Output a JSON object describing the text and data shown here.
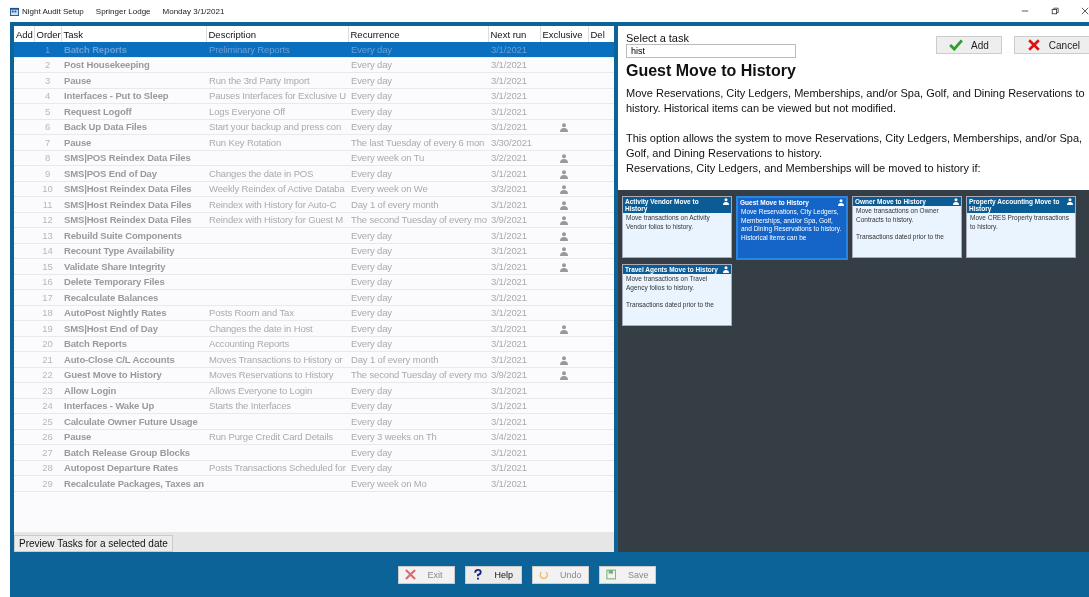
{
  "title_bar": {
    "app": "Night Audit Setup",
    "property": "Springer Lodge",
    "date": "Monday 3/1/2021"
  },
  "table": {
    "columns": [
      "Add",
      "Order",
      "Task",
      "Description",
      "Recurrence",
      "Next run",
      "Exclusive",
      "Del"
    ],
    "rows": [
      {
        "order": "1",
        "task": "Batch Reports",
        "description": "Preliminary Reports",
        "recurrence": "Every day",
        "next_run": "3/1/2021",
        "exclusive": false,
        "selected": true
      },
      {
        "order": "2",
        "task": "Post Housekeeping",
        "description": "",
        "recurrence": "Every day",
        "next_run": "3/1/2021",
        "exclusive": false,
        "selected": false
      },
      {
        "order": "3",
        "task": "Pause",
        "description": "Run the 3rd Party Import",
        "recurrence": "Every day",
        "next_run": "3/1/2021",
        "exclusive": false,
        "selected": false
      },
      {
        "order": "4",
        "task": "Interfaces - Put to Sleep",
        "description": "Pauses Interfaces for Exclusive U",
        "recurrence": "Every day",
        "next_run": "3/1/2021",
        "exclusive": false,
        "selected": false
      },
      {
        "order": "5",
        "task": "Request Logoff",
        "description": "Logs Everyone Off",
        "recurrence": "Every day",
        "next_run": "3/1/2021",
        "exclusive": false,
        "selected": false
      },
      {
        "order": "6",
        "task": "Back Up Data Files",
        "description": "Start your backup and press con",
        "recurrence": "Every day",
        "next_run": "3/1/2021",
        "exclusive": true,
        "selected": false
      },
      {
        "order": "7",
        "task": "Pause",
        "description": "Run Key Rotation",
        "recurrence": "The last Tuesday of every 6 mon",
        "next_run": "3/30/2021",
        "exclusive": false,
        "selected": false
      },
      {
        "order": "8",
        "task": "SMS|POS Reindex Data Files",
        "description": "",
        "recurrence": "Every week on Tu",
        "next_run": "3/2/2021",
        "exclusive": true,
        "selected": false
      },
      {
        "order": "9",
        "task": "SMS|POS End of Day",
        "description": "Changes the date in POS",
        "recurrence": "Every day",
        "next_run": "3/1/2021",
        "exclusive": true,
        "selected": false
      },
      {
        "order": "10",
        "task": "SMS|Host Reindex Data Files",
        "description": "Weekly Reindex of Active Databa",
        "recurrence": "Every week on We",
        "next_run": "3/3/2021",
        "exclusive": true,
        "selected": false
      },
      {
        "order": "11",
        "task": "SMS|Host Reindex Data Files",
        "description": "Reindex with History for Auto-C",
        "recurrence": "Day 1 of every month",
        "next_run": "3/1/2021",
        "exclusive": true,
        "selected": false
      },
      {
        "order": "12",
        "task": "SMS|Host Reindex Data Files",
        "description": "Reindex with History for Guest M",
        "recurrence": "The second Tuesday of every mo",
        "next_run": "3/9/2021",
        "exclusive": true,
        "selected": false
      },
      {
        "order": "13",
        "task": "Rebuild Suite Components",
        "description": "",
        "recurrence": "Every day",
        "next_run": "3/1/2021",
        "exclusive": true,
        "selected": false
      },
      {
        "order": "14",
        "task": "Recount Type Availability",
        "description": "",
        "recurrence": "Every day",
        "next_run": "3/1/2021",
        "exclusive": true,
        "selected": false
      },
      {
        "order": "15",
        "task": "Validate Share Integrity",
        "description": "",
        "recurrence": "Every day",
        "next_run": "3/1/2021",
        "exclusive": true,
        "selected": false
      },
      {
        "order": "16",
        "task": "Delete Temporary Files",
        "description": "",
        "recurrence": "Every day",
        "next_run": "3/1/2021",
        "exclusive": false,
        "selected": false
      },
      {
        "order": "17",
        "task": "Recalculate Balances",
        "description": "",
        "recurrence": "Every day",
        "next_run": "3/1/2021",
        "exclusive": false,
        "selected": false
      },
      {
        "order": "18",
        "task": "AutoPost Nightly Rates",
        "description": "Posts Room and Tax",
        "recurrence": "Every day",
        "next_run": "3/1/2021",
        "exclusive": false,
        "selected": false
      },
      {
        "order": "19",
        "task": "SMS|Host End of Day",
        "description": "Changes the date in Host",
        "recurrence": "Every day",
        "next_run": "3/1/2021",
        "exclusive": true,
        "selected": false
      },
      {
        "order": "20",
        "task": "Batch Reports",
        "description": "Accounting Reports",
        "recurrence": "Every day",
        "next_run": "3/1/2021",
        "exclusive": false,
        "selected": false
      },
      {
        "order": "21",
        "task": "Auto-Close C/L Accounts",
        "description": "Moves Transactions to History or",
        "recurrence": "Day 1 of every month",
        "next_run": "3/1/2021",
        "exclusive": true,
        "selected": false
      },
      {
        "order": "22",
        "task": "Guest Move to History",
        "description": "Moves Reservations to History",
        "recurrence": "The second Tuesday of every mo",
        "next_run": "3/9/2021",
        "exclusive": true,
        "selected": false
      },
      {
        "order": "23",
        "task": "Allow Login",
        "description": "Allows Everyone to Login",
        "recurrence": "Every day",
        "next_run": "3/1/2021",
        "exclusive": false,
        "selected": false
      },
      {
        "order": "24",
        "task": "Interfaces - Wake Up",
        "description": "Starts the Interfaces",
        "recurrence": "Every day",
        "next_run": "3/1/2021",
        "exclusive": false,
        "selected": false
      },
      {
        "order": "25",
        "task": "Calculate Owner Future Usage",
        "description": "",
        "recurrence": "Every day",
        "next_run": "3/1/2021",
        "exclusive": false,
        "selected": false
      },
      {
        "order": "26",
        "task": "Pause",
        "description": "Run Purge Credit Card Details",
        "recurrence": "Every 3 weeks on Th",
        "next_run": "3/4/2021",
        "exclusive": false,
        "selected": false
      },
      {
        "order": "27",
        "task": "Batch Release Group Blocks",
        "description": "",
        "recurrence": "Every day",
        "next_run": "3/1/2021",
        "exclusive": false,
        "selected": false
      },
      {
        "order": "28",
        "task": "Autopost Departure Rates",
        "description": "Posts Transactions Scheduled for",
        "recurrence": "Every day",
        "next_run": "3/1/2021",
        "exclusive": false,
        "selected": false
      },
      {
        "order": "29",
        "task": "Recalculate Packages, Taxes an",
        "description": "",
        "recurrence": "Every week on Mo",
        "next_run": "3/1/2021",
        "exclusive": false,
        "selected": false
      }
    ]
  },
  "preview_tab": "Preview Tasks for a selected date",
  "task_picker": {
    "label": "Select a task",
    "search_value": "hist",
    "add": "Add",
    "cancel": "Cancel",
    "heading": "Guest Move to History",
    "paragraphs": [
      "Move Reservations, City Ledgers, Memberships, and/or Spa, Golf, and Dining Reservations to history.  Historical items can be viewed but not modified.",
      "This option allows the system to move Reservations, City Ledgers, Memberships, and/or Spa, Golf, and Dining Reservations to history.",
      "Reservations, City Ledgers, and Memberships will be moved to history if:"
    ]
  },
  "cards": [
    {
      "title": "Activity Vendor Move to History",
      "body": "Move transactions on Activity Vendor folios to history.",
      "exclusive": true,
      "selected": false
    },
    {
      "title": "Guest Move to History",
      "body": "Move Reservations, City Ledgers, Memberships, and/or Spa, Golf, and Dining Reservations to history.  Historical items can be",
      "exclusive": true,
      "selected": true
    },
    {
      "title": "Owner Move to History",
      "body": "Move transactions on Owner Contracts to history.\n\nTransactions dated prior to the",
      "exclusive": true,
      "selected": false
    },
    {
      "title": "Property Accounting Move to History",
      "body": "Move CRES Property transactions to history.",
      "exclusive": true,
      "selected": false
    },
    {
      "title": "Travel Agents Move to History",
      "body": "Move transactions on Travel Agency folios to history.\n\nTransactions dated prior to the",
      "exclusive": true,
      "selected": false
    }
  ],
  "footer_buttons": [
    {
      "kind": "exit",
      "label": "Exit",
      "disabled": true
    },
    {
      "kind": "help",
      "label": "Help",
      "disabled": false
    },
    {
      "kind": "undo",
      "label": "Undo",
      "disabled": true
    },
    {
      "kind": "save",
      "label": "Save",
      "disabled": true
    }
  ]
}
